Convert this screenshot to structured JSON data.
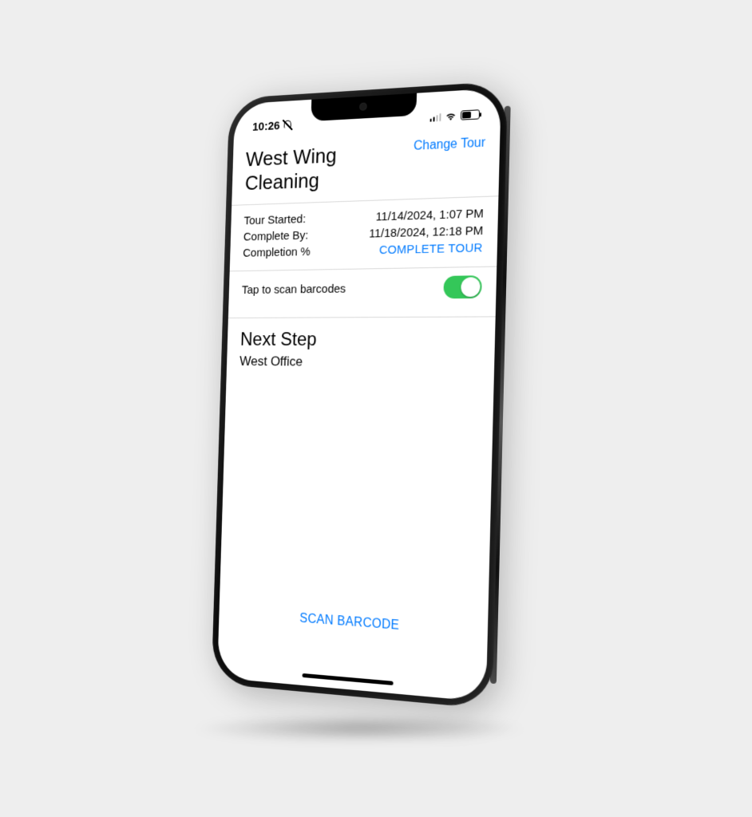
{
  "status_bar": {
    "time": "10:26"
  },
  "header": {
    "title": "West Wing Cleaning",
    "change_tour": "Change Tour"
  },
  "info": {
    "started_label": "Tour Started:",
    "started_value": "11/14/2024, 1:07 PM",
    "complete_by_label": "Complete By:",
    "complete_by_value": "11/18/2024, 12:18 PM",
    "completion_label": "Completion %",
    "complete_tour": "COMPLETE TOUR"
  },
  "toggle": {
    "label": "Tap to scan barcodes",
    "on": true
  },
  "next_step": {
    "heading": "Next Step",
    "value": "West Office"
  },
  "scan_barcode": "SCAN BARCODE",
  "colors": {
    "ios_blue": "#007aff",
    "ios_green": "#34c759"
  }
}
